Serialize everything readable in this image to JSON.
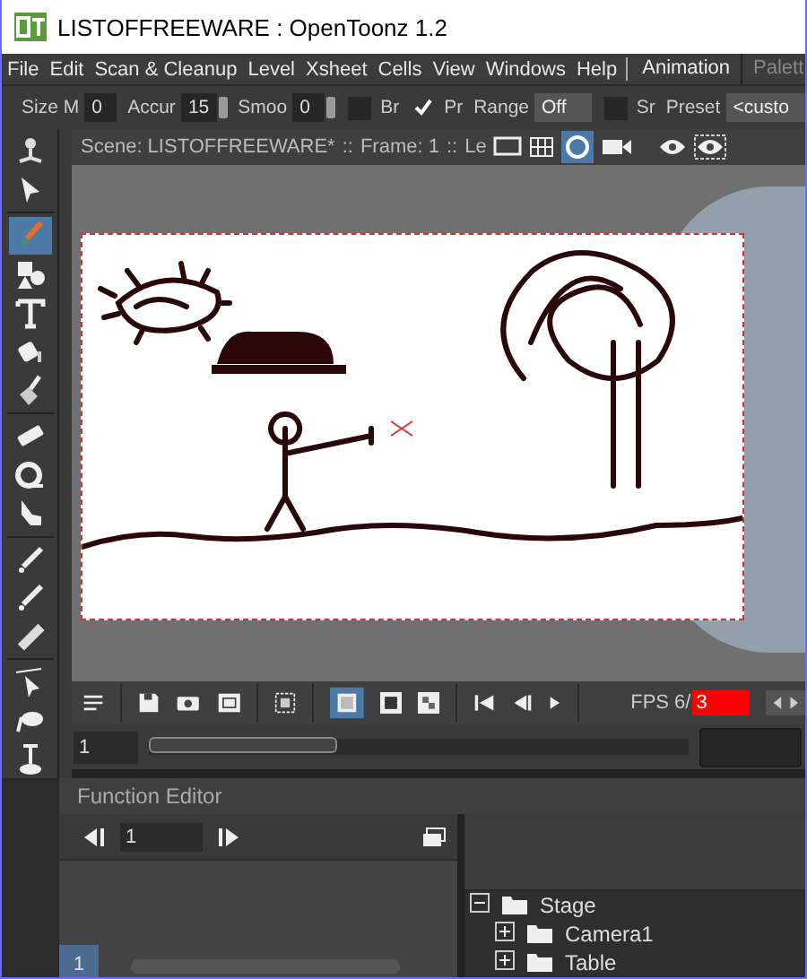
{
  "window": {
    "title": "LISTOFFREEWARE : OpenToonz 1.2"
  },
  "menu": [
    "File",
    "Edit",
    "Scan & Cleanup",
    "Level",
    "Xsheet",
    "Cells",
    "View",
    "Windows",
    "Help"
  ],
  "rooms": [
    {
      "label": "Animation",
      "selected": true
    },
    {
      "label": "Palett",
      "selected": false
    }
  ],
  "tool_options": [
    {
      "kind": "label",
      "text": "Size M"
    },
    {
      "kind": "field",
      "value": "0"
    },
    {
      "kind": "label",
      "text": "Accur"
    },
    {
      "kind": "spin",
      "value": "15"
    },
    {
      "kind": "label",
      "text": "Smoo"
    },
    {
      "kind": "spin",
      "value": "0"
    },
    {
      "kind": "checkbox",
      "label": "Br",
      "checked": false
    },
    {
      "kind": "checkbox",
      "label": "Pr",
      "checked": true
    },
    {
      "kind": "label",
      "text": "Range"
    },
    {
      "kind": "dropdown",
      "value": "Off"
    },
    {
      "kind": "checkbox",
      "label": "Sr",
      "checked": false
    },
    {
      "kind": "label",
      "text": "Preset"
    },
    {
      "kind": "dropdown",
      "value": "<custo"
    }
  ],
  "tools": [
    {
      "kind": "animate",
      "selected": false
    },
    {
      "kind": "selection",
      "selected": false
    },
    {
      "kind": "brush",
      "selected": true
    },
    {
      "kind": "geometric",
      "selected": false
    },
    {
      "kind": "type",
      "selected": false
    },
    {
      "kind": "fill",
      "selected": false
    },
    {
      "kind": "paint",
      "selected": false
    },
    {
      "kind": "eraser",
      "selected": false
    },
    {
      "kind": "tape",
      "selected": false
    },
    {
      "kind": "finger",
      "selected": false
    },
    {
      "kind": "picker",
      "selected": false
    },
    {
      "kind": "picker",
      "selected": false
    },
    {
      "kind": "ruler",
      "selected": false
    },
    {
      "kind": "control",
      "selected": false
    },
    {
      "kind": "hand",
      "selected": false
    },
    {
      "kind": "pump",
      "selected": false
    }
  ],
  "viewer": {
    "header": [
      "Scene: LISTOFFREEWARE*",
      "::",
      "Frame: 1",
      "::",
      "Le"
    ]
  },
  "playback": {
    "fps_label": "FPS 6/",
    "fps_value": "3",
    "frame": "1",
    "frame_slider": {
      "level": 0.35
    }
  },
  "function_editor": {
    "title": "Function Editor",
    "frame": "1",
    "row": "1",
    "tree": [
      {
        "label": "Stage",
        "expanded": true,
        "children": [
          {
            "label": "Camera1",
            "expanded": false
          },
          {
            "label": "Table",
            "expanded": false
          }
        ]
      }
    ]
  }
}
